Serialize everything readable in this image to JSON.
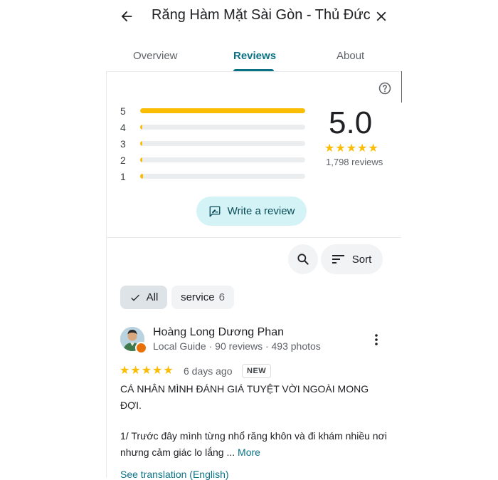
{
  "header": {
    "title": "Răng Hàm Mặt Sài Gòn - Thủ Đức",
    "back_icon": "arrow-back-icon",
    "close_icon": "close-icon"
  },
  "tabs": [
    {
      "label": "Overview",
      "active": false
    },
    {
      "label": "Reviews",
      "active": true
    },
    {
      "label": "About",
      "active": false
    }
  ],
  "rating": {
    "score": "5.0",
    "stars": 5,
    "review_count": "1,798 reviews",
    "distribution": [
      {
        "label": "5",
        "fraction": 1.0
      },
      {
        "label": "4",
        "fraction": 0.012
      },
      {
        "label": "3",
        "fraction": 0.006
      },
      {
        "label": "2",
        "fraction": 0.006
      },
      {
        "label": "1",
        "fraction": 0.018
      }
    ]
  },
  "write_review": {
    "label": "Write a review",
    "icon": "rate-review-icon"
  },
  "toolbar": {
    "search_icon": "search-icon",
    "sort_label": "Sort",
    "sort_icon": "sort-icon"
  },
  "filters": [
    {
      "label": "All",
      "count": "",
      "selected": true
    },
    {
      "label": "service",
      "count": "6",
      "selected": false
    }
  ],
  "review": {
    "author": "Hoàng Long Dương Phan",
    "meta": "Local Guide · 90 reviews · 493 photos",
    "stars": 5,
    "date": "6 days ago",
    "badge": "NEW",
    "text_line1": "CÁ NHÂN MÌNH ĐÁNH GIÁ TUYỆT VỜI NGOÀI MONG ĐỢI.",
    "text_line2": "1/ Trước đây mình từng nhổ răng khôn và đi khám nhiều nơi nhưng cảm giác lo lắng ...",
    "more_label": "More",
    "translation_label": "See translation (English)"
  },
  "colors": {
    "accent": "#0b7285",
    "star": "#fbbc04",
    "chip_selected": "#dde3e6",
    "write_button": "#d3f3f7"
  }
}
